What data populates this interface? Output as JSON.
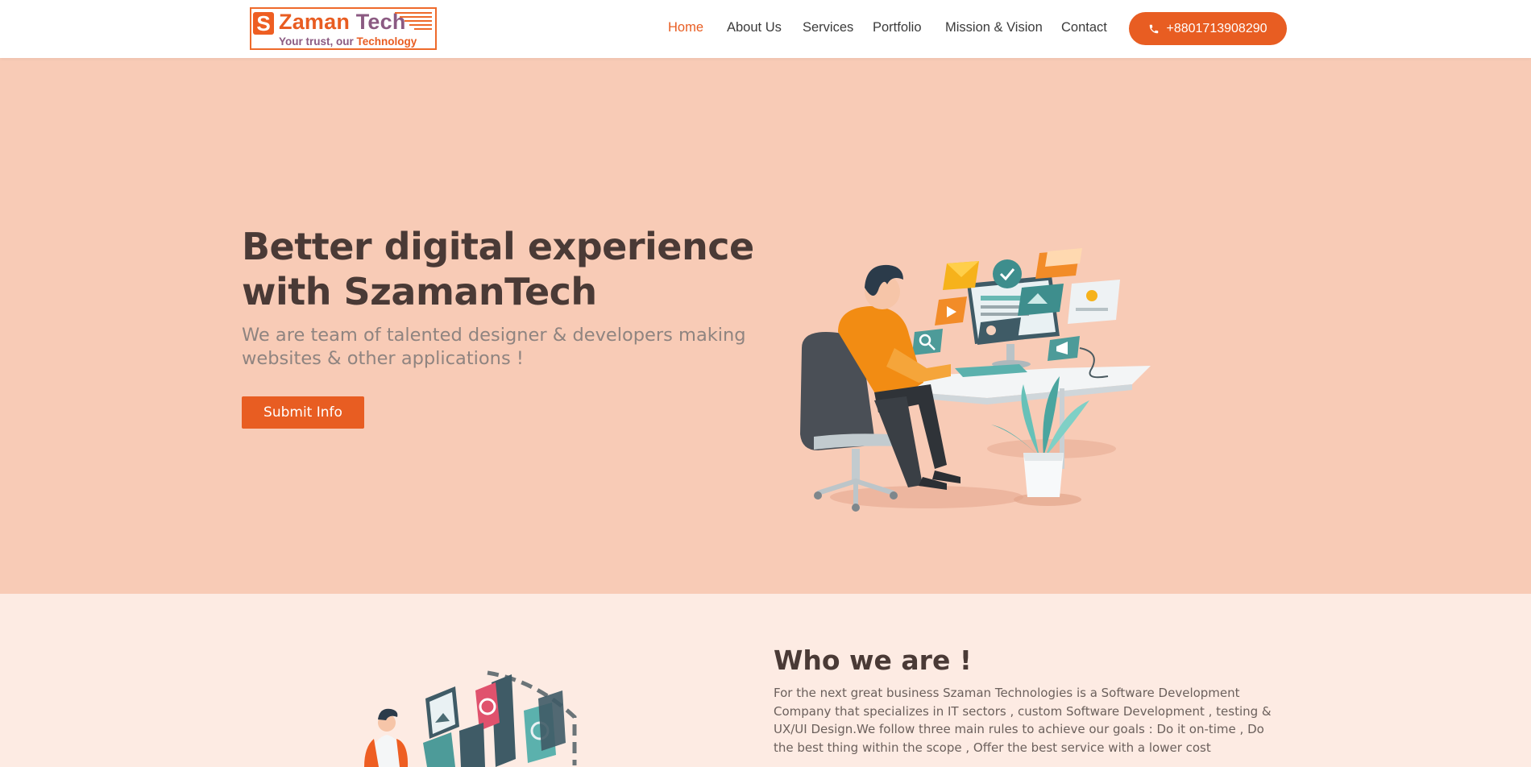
{
  "brand": {
    "logo_letter": "S",
    "logo_name_1": "Zaman",
    "logo_name_2": "Tech",
    "tagline_1": "Your trust, our ",
    "tagline_2": "Technology",
    "accent_color": "#e85d22"
  },
  "nav": {
    "items": [
      {
        "label": "Home",
        "active": true
      },
      {
        "label": "About Us",
        "active": false
      },
      {
        "label": "Services",
        "active": false
      },
      {
        "label": "Portfolio",
        "active": false
      },
      {
        "label": "Mission & Vision",
        "active": false
      },
      {
        "label": "Contact",
        "active": false
      }
    ],
    "phone": "+8801713908290",
    "phone_icon": "phone-icon"
  },
  "hero": {
    "title_line1": "Better digital experience",
    "title_line2": "with SzamanTech",
    "subtitle_line1": "We are team of talented designer & developers making",
    "subtitle_line2": "websites & other applications !",
    "button": "Submit Info",
    "background_color": "#f8cbb6"
  },
  "about": {
    "title": "Who we are !",
    "text": "For the next great business Szaman Technologies is a Software Development Company that specializes in IT sectors , custom Software Development , testing & UX/UI Design.We follow three main rules to achieve our goals : Do it on-time , Do the best thing within the scope , Offer the best service with a lower cost",
    "background_color": "#fdebe3"
  }
}
